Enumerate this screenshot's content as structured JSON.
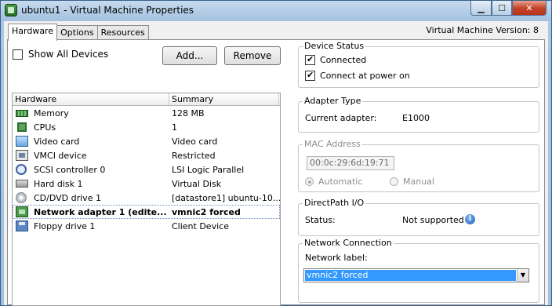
{
  "window": {
    "title": "ubuntu1 - Virtual Machine Properties",
    "controls": {
      "minimize": "▁",
      "maximize": "☐",
      "close": "✕"
    }
  },
  "tabs": [
    {
      "label": "Hardware",
      "active": true
    },
    {
      "label": "Options",
      "active": false
    },
    {
      "label": "Resources",
      "active": false
    }
  ],
  "vm_version": "Virtual Machine Version: 8",
  "toolbar": {
    "show_all_devices": "Show All Devices",
    "show_all_checked": false,
    "add_label": "Add...",
    "remove_label": "Remove"
  },
  "hardware_table": {
    "columns": [
      "Hardware",
      "Summary"
    ],
    "rows": [
      {
        "icon": "memory-icon",
        "hardware": "Memory",
        "summary": "128 MB"
      },
      {
        "icon": "cpu-icon",
        "hardware": "CPUs",
        "summary": "1"
      },
      {
        "icon": "video-card-icon",
        "hardware": "Video card",
        "summary": "Video card"
      },
      {
        "icon": "vmci-icon",
        "hardware": "VMCI device",
        "summary": "Restricted"
      },
      {
        "icon": "scsi-icon",
        "hardware": "SCSI controller 0",
        "summary": "LSI Logic Parallel"
      },
      {
        "icon": "hard-disk-icon",
        "hardware": "Hard disk 1",
        "summary": "Virtual Disk"
      },
      {
        "icon": "cd-dvd-icon",
        "hardware": "CD/DVD drive 1",
        "summary": "[datastore1] ubuntu-10..."
      },
      {
        "icon": "network-adapter-icon",
        "hardware": "Network adapter 1 (edite...",
        "summary": "vmnic2 forced",
        "selected": true
      },
      {
        "icon": "floppy-icon",
        "hardware": "Floppy drive 1",
        "summary": "Client Device"
      }
    ]
  },
  "device_status": {
    "legend": "Device Status",
    "connected_label": "Connected",
    "connected": true,
    "connect_power_on_label": "Connect at power on",
    "connect_power_on": true
  },
  "adapter_type": {
    "legend": "Adapter Type",
    "current_label": "Current adapter:",
    "current_value": "E1000"
  },
  "mac_address": {
    "legend": "MAC Address",
    "value": "00:0c:29:6d:19:71",
    "automatic_label": "Automatic",
    "manual_label": "Manual",
    "selected": "automatic"
  },
  "directpath": {
    "legend": "DirectPath I/O",
    "status_label": "Status:",
    "status_value": "Not supported"
  },
  "network_connection": {
    "legend": "Network Connection",
    "label": "Network label:",
    "selected": "vmnic2 forced"
  },
  "colors": {
    "selection_blue": "#3399ff",
    "window_frame": "#a9c8e6",
    "close_red": "#c4452b"
  }
}
